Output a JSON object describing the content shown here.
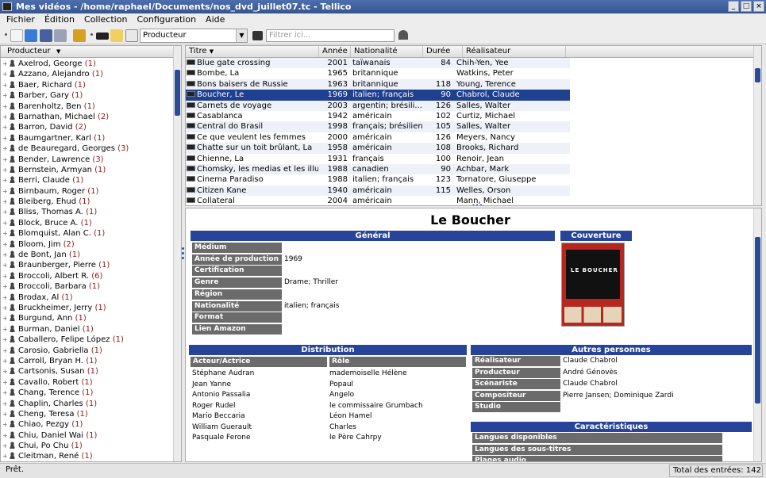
{
  "window": {
    "title": "Mes vidéos - /home/raphael/Documents/nos_dvd_juillet07.tc - Tellico"
  },
  "menu": [
    "Fichier",
    "Édition",
    "Collection",
    "Configuration",
    "Aide"
  ],
  "toolbar": {
    "group_combo": "Producteur",
    "filter_placeholder": "Filtrer ici..."
  },
  "left": {
    "header": "Producteur",
    "items": [
      {
        "name": "Axelrod, George",
        "count": "(1)"
      },
      {
        "name": "Azzano, Alejandro",
        "count": "(1)"
      },
      {
        "name": "Baer, Richard",
        "count": "(1)"
      },
      {
        "name": "Barber, Gary",
        "count": "(1)"
      },
      {
        "name": "Barenholtz, Ben",
        "count": "(1)"
      },
      {
        "name": "Barnathan, Michael",
        "count": "(2)"
      },
      {
        "name": "Barron, David",
        "count": "(2)"
      },
      {
        "name": "Baumgartner, Karl",
        "count": "(1)"
      },
      {
        "name": "de Beauregard, Georges",
        "count": "(3)"
      },
      {
        "name": "Bender, Lawrence",
        "count": "(3)"
      },
      {
        "name": "Bernstein, Armyan",
        "count": "(1)"
      },
      {
        "name": "Berri, Claude",
        "count": "(1)"
      },
      {
        "name": "Birnbaum, Roger",
        "count": "(1)"
      },
      {
        "name": "Bleiberg, Ehud",
        "count": "(1)"
      },
      {
        "name": "Bliss, Thomas A.",
        "count": "(1)"
      },
      {
        "name": "Block, Bruce A.",
        "count": "(1)"
      },
      {
        "name": "Blomquist, Alan C.",
        "count": "(1)"
      },
      {
        "name": "Bloom, Jim",
        "count": "(2)"
      },
      {
        "name": "de Bont, Jan",
        "count": "(1)"
      },
      {
        "name": "Braunberger, Pierre",
        "count": "(1)"
      },
      {
        "name": "Broccoli, Albert R.",
        "count": "(6)"
      },
      {
        "name": "Broccoli, Barbara",
        "count": "(1)"
      },
      {
        "name": "Brodax, Al",
        "count": "(1)"
      },
      {
        "name": "Bruckheimer, Jerry",
        "count": "(1)"
      },
      {
        "name": "Burgund, Ann",
        "count": "(1)"
      },
      {
        "name": "Burman, Daniel",
        "count": "(1)"
      },
      {
        "name": "Caballero, Felipe López",
        "count": "(1)"
      },
      {
        "name": "Carosio, Gabriella",
        "count": "(1)"
      },
      {
        "name": "Carroll, Bryan H.",
        "count": "(1)"
      },
      {
        "name": "Cartsonis, Susan",
        "count": "(1)"
      },
      {
        "name": "Cavallo, Robert",
        "count": "(1)"
      },
      {
        "name": "Chang, Terence",
        "count": "(1)"
      },
      {
        "name": "Chaplin, Charles",
        "count": "(1)"
      },
      {
        "name": "Cheng, Teresa",
        "count": "(1)"
      },
      {
        "name": "Chiao, Pezgy",
        "count": "(1)"
      },
      {
        "name": "Chiu, Daniel Wai",
        "count": "(1)"
      },
      {
        "name": "Chui, Po Chu",
        "count": "(1)"
      },
      {
        "name": "Cleitman, René",
        "count": "(1)"
      }
    ]
  },
  "list": {
    "columns": [
      "Titre",
      "Année d",
      "Nationalité",
      "Durée",
      "Réalisateur"
    ],
    "rows": [
      {
        "titre": "Blue gate crossing",
        "annee": "2001",
        "nat": "taïwanais",
        "duree": "84",
        "real": "Chih-Yen, Yee"
      },
      {
        "titre": "Bombe, La",
        "annee": "1965",
        "nat": "britannique",
        "duree": "",
        "real": "Watkins, Peter"
      },
      {
        "titre": "Bons baisers de Russie",
        "annee": "1963",
        "nat": "britannique",
        "duree": "118",
        "real": "Young, Terence"
      },
      {
        "titre": "Boucher, Le",
        "annee": "1969",
        "nat": "italien; français",
        "duree": "90",
        "real": "Chabrol, Claude",
        "selected": true
      },
      {
        "titre": "Carnets de voyage",
        "annee": "2003",
        "nat": "argentin; brésili...",
        "duree": "126",
        "real": "Salles, Walter"
      },
      {
        "titre": "Casablanca",
        "annee": "1942",
        "nat": "américain",
        "duree": "102",
        "real": "Curtiz, Michael"
      },
      {
        "titre": "Central do Brasil",
        "annee": "1998",
        "nat": "français; brésilien",
        "duree": "105",
        "real": "Salles, Walter"
      },
      {
        "titre": "Ce que veulent les femmes",
        "annee": "2000",
        "nat": "américain",
        "duree": "126",
        "real": "Meyers, Nancy"
      },
      {
        "titre": "Chatte sur un toit brûlant, La",
        "annee": "1958",
        "nat": "américain",
        "duree": "108",
        "real": "Brooks, Richard"
      },
      {
        "titre": "Chienne, La",
        "annee": "1931",
        "nat": "français",
        "duree": "100",
        "real": "Renoir, Jean"
      },
      {
        "titre": "Chomsky, les medias et les illu...",
        "annee": "1988",
        "nat": "canadien",
        "duree": "90",
        "real": "Achbar, Mark"
      },
      {
        "titre": "Cinema Paradiso",
        "annee": "1988",
        "nat": "italien; français",
        "duree": "123",
        "real": "Tornatore, Giuseppe"
      },
      {
        "titre": "Citizen Kane",
        "annee": "1940",
        "nat": "américain",
        "duree": "115",
        "real": "Welles, Orson"
      },
      {
        "titre": "Collateral",
        "annee": "2004",
        "nat": "américain",
        "duree": "",
        "real": "Mann, Michael"
      }
    ]
  },
  "detail": {
    "title": "Le Boucher",
    "general_header": "Général",
    "cover_header": "Couverture",
    "cover_text": "LE BOUCHER",
    "general": [
      {
        "label": "Médium",
        "value": ""
      },
      {
        "label": "Année de production",
        "value": "1969"
      },
      {
        "label": "Certification",
        "value": ""
      },
      {
        "label": "Genre",
        "value": "Drame; Thriller"
      },
      {
        "label": "Région",
        "value": ""
      },
      {
        "label": "Nationalité",
        "value": "italien; français"
      },
      {
        "label": "Format",
        "value": ""
      },
      {
        "label": "Lien Amazon",
        "value": ""
      }
    ],
    "distribution_header": "Distribution",
    "cast_col1": "Acteur/Actrice",
    "cast_col2": "Rôle",
    "cast": [
      {
        "actor": "Stéphane Audran",
        "role": "mademoiselle Hélène"
      },
      {
        "actor": "Jean Yanne",
        "role": "Popaul"
      },
      {
        "actor": "Antonio Passalia",
        "role": "Angelo"
      },
      {
        "actor": "Roger Rudel",
        "role": "le commissaire Grumbach"
      },
      {
        "actor": "Mario Beccaria",
        "role": "Léon Hamel"
      },
      {
        "actor": "William Guerault",
        "role": "Charles"
      },
      {
        "actor": "Pasquale Ferone",
        "role": "le Père Cahrpy"
      }
    ],
    "others_header": "Autres personnes",
    "others": [
      {
        "label": "Réalisateur",
        "value": "Claude Chabrol"
      },
      {
        "label": "Producteur",
        "value": "André Génovès"
      },
      {
        "label": "Scénariste",
        "value": "Claude Chabrol"
      },
      {
        "label": "Compositeur",
        "value": "Pierre Jansen; Dominique Zardi"
      },
      {
        "label": "Studio",
        "value": ""
      }
    ],
    "features_header": "Caractéristiques",
    "features": [
      "Langues disponibles",
      "Langues des sous-titres",
      "Plages audio"
    ]
  },
  "status": {
    "left": "Prêt.",
    "right": "Total des entrées: 142"
  }
}
